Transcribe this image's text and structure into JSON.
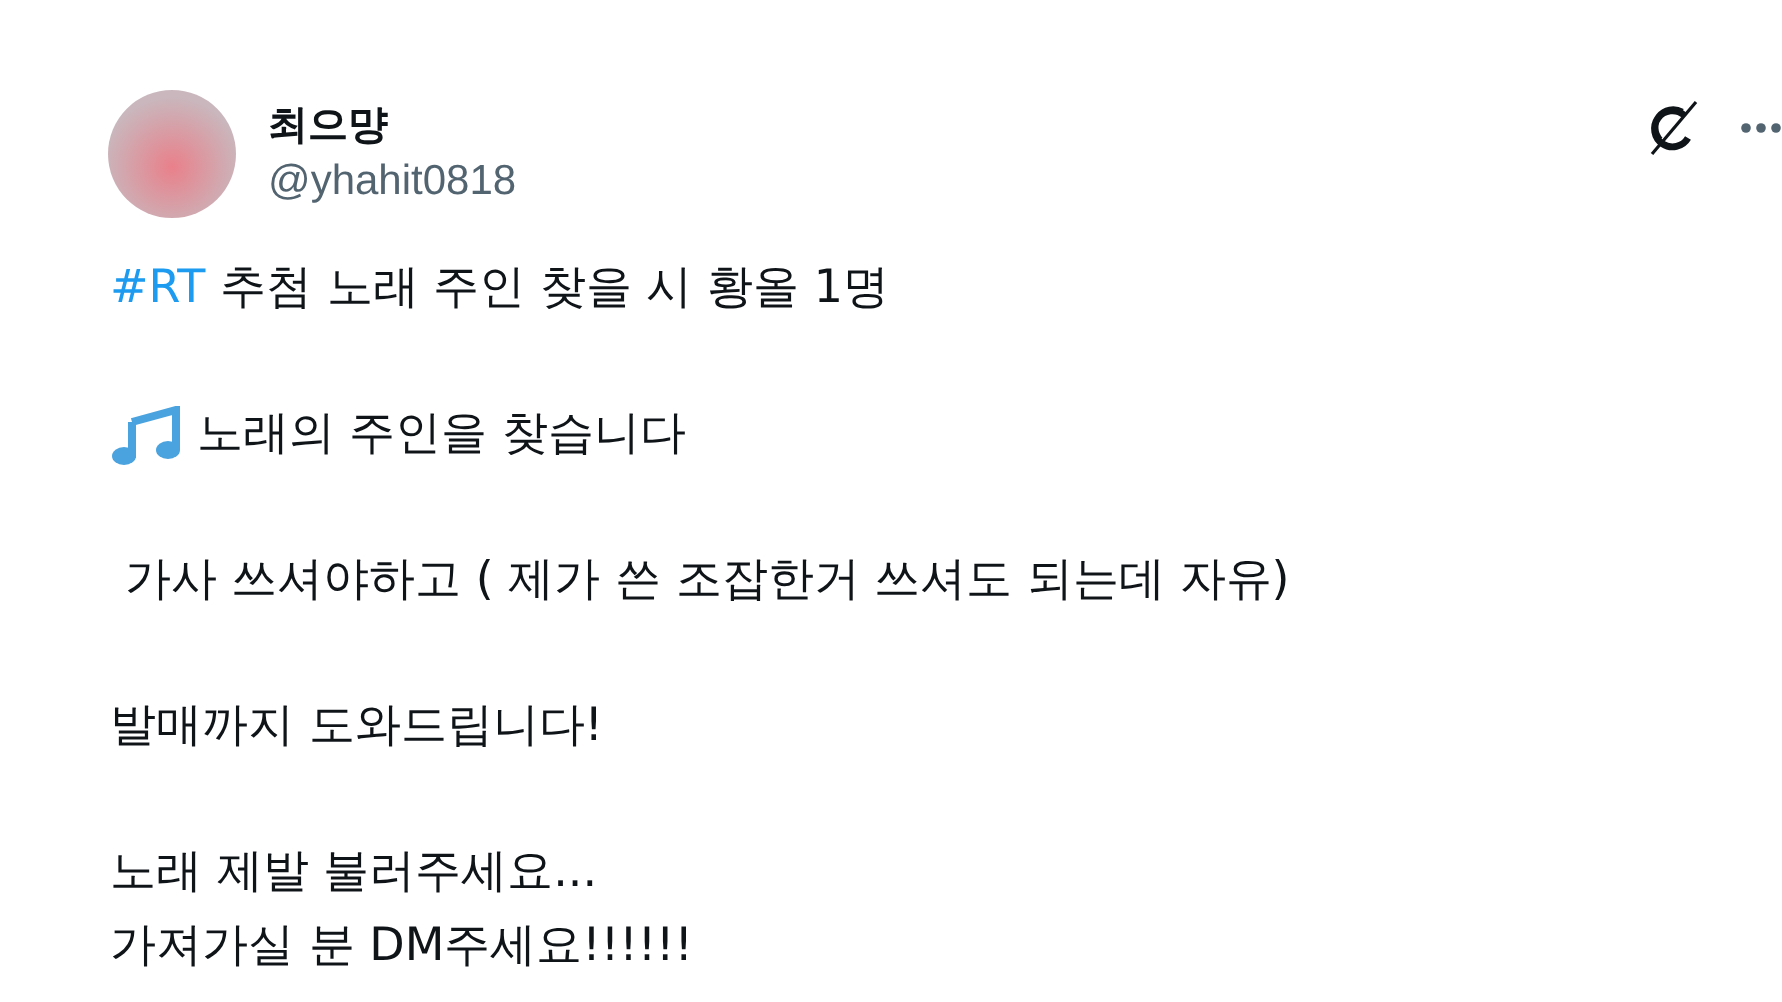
{
  "author": {
    "name": "최으먕",
    "handle": "@yhahit0818"
  },
  "paragraphs": [
    {
      "kind": "hashtag",
      "hashtag": "#RT",
      "text": " 추첨 노래 주인 찾을 시 황올 1명"
    },
    {
      "kind": "music",
      "text": " 노래의 주인을 찾습니다"
    },
    {
      "kind": "plain",
      "text": " 가사 쓰셔야하고 ( 제가 쓴 조잡한거 쓰셔도 되는데 자유)"
    },
    {
      "kind": "plain",
      "text": "발매까지 도와드립니다!"
    },
    {
      "kind": "plain",
      "text": "노래 제발 불러주세요...\n가져가실 분 DM주세요!!!!!!"
    }
  ]
}
